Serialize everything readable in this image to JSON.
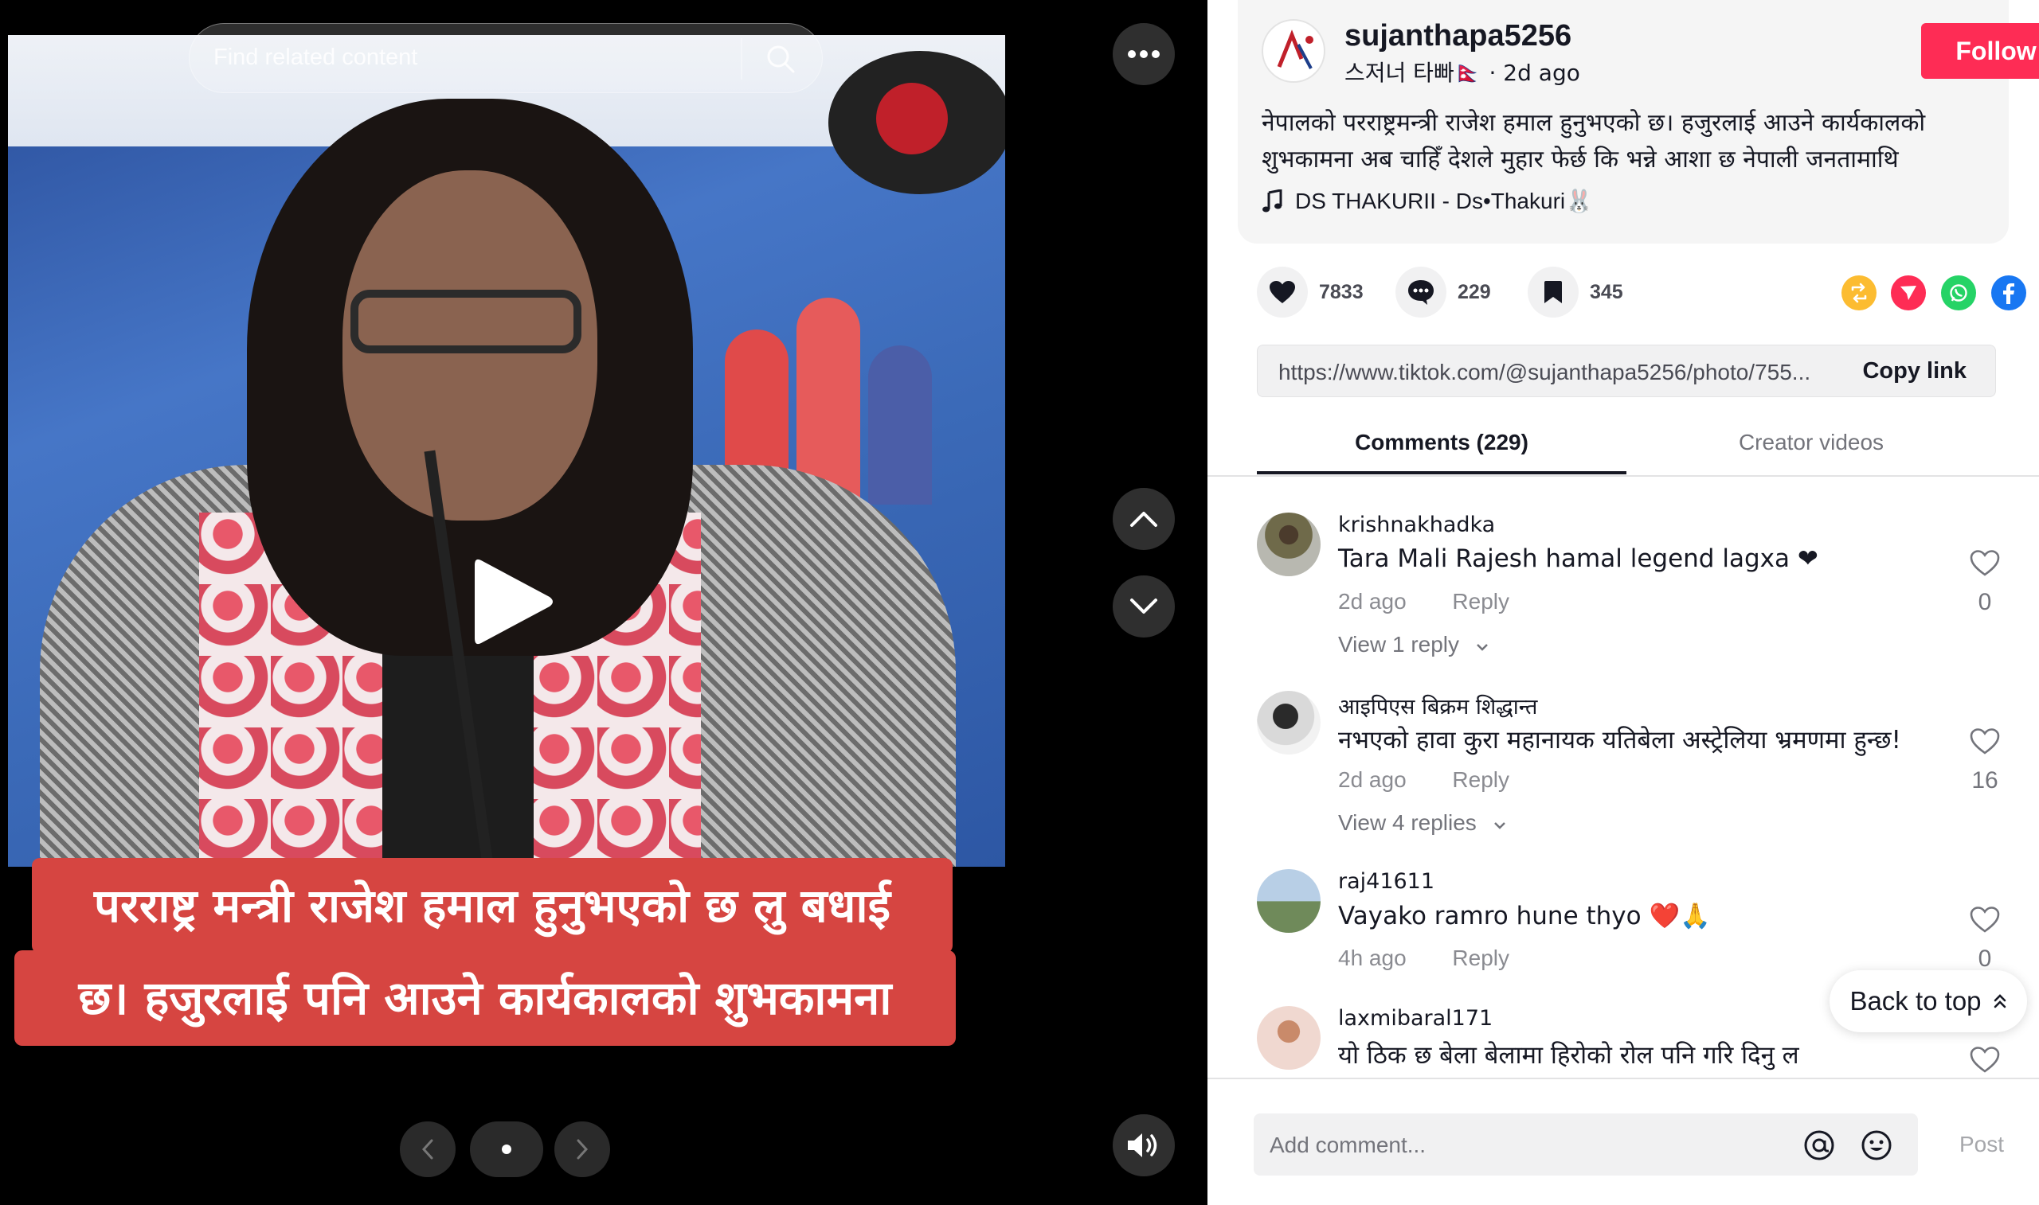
{
  "search": {
    "placeholder": "Find related content"
  },
  "caption": {
    "line1": "परराष्ट्र मन्त्री राजेश हमाल हुनुभएको छ लु बधाई",
    "line2": "छ। हजुरलाई पनि आउने कार्यकालको शुभकामना"
  },
  "post": {
    "username": "sujanthapa5256",
    "display_name": "스저너 타빠🇳🇵",
    "time": "2d ago",
    "follow_label": "Follow",
    "description": "नेपालको परराष्ट्रमन्त्री राजेश हमाल हुनुभएको छ। हजुरलाई आउने कार्यकालको शुभकामना अब चाहिँ देशले मुहार फेर्छ कि भन्ने आशा छ नेपाली जनतामाथि",
    "music": "DS THAKURII - Ds•Thakuri🐰"
  },
  "actions": {
    "likes": "7833",
    "comments": "229",
    "saves": "345"
  },
  "share": {
    "link": "https://www.tiktok.com/@sujanthapa5256/photo/755...",
    "copy_label": "Copy link"
  },
  "tabs": {
    "comments": "Comments (229)",
    "creator": "Creator videos"
  },
  "comments": [
    {
      "user": "krishnakhadka",
      "text": "Tara Mali Rajesh hamal legend lagxa ❤",
      "time": "2d ago",
      "reply": "Reply",
      "likes": "0",
      "view": "View 1 reply"
    },
    {
      "user": "आइपिएस बिक्रम शिद्धान्त",
      "text": "नभएको हावा कुरा महानायक यतिबेला अस्ट्रेलिया भ्रमणमा हुन्छ!",
      "time": "2d ago",
      "reply": "Reply",
      "likes": "16",
      "view": "View 4 replies"
    },
    {
      "user": "raj41611",
      "text": "Vayako ramro hune thyo ❤️🙏",
      "time": "4h ago",
      "reply": "Reply",
      "likes": "0"
    },
    {
      "user": "laxmibaral171",
      "text": "यो ठिक छ बेला बेलामा हिरोको रोल पनि गरि दिनु ल",
      "likes": ""
    }
  ],
  "back_to_top": "Back to top",
  "composer": {
    "placeholder": "Add comment...",
    "post_label": "Post"
  },
  "colors": {
    "accent": "#fe2c55",
    "caption_bg": "#d64541"
  }
}
